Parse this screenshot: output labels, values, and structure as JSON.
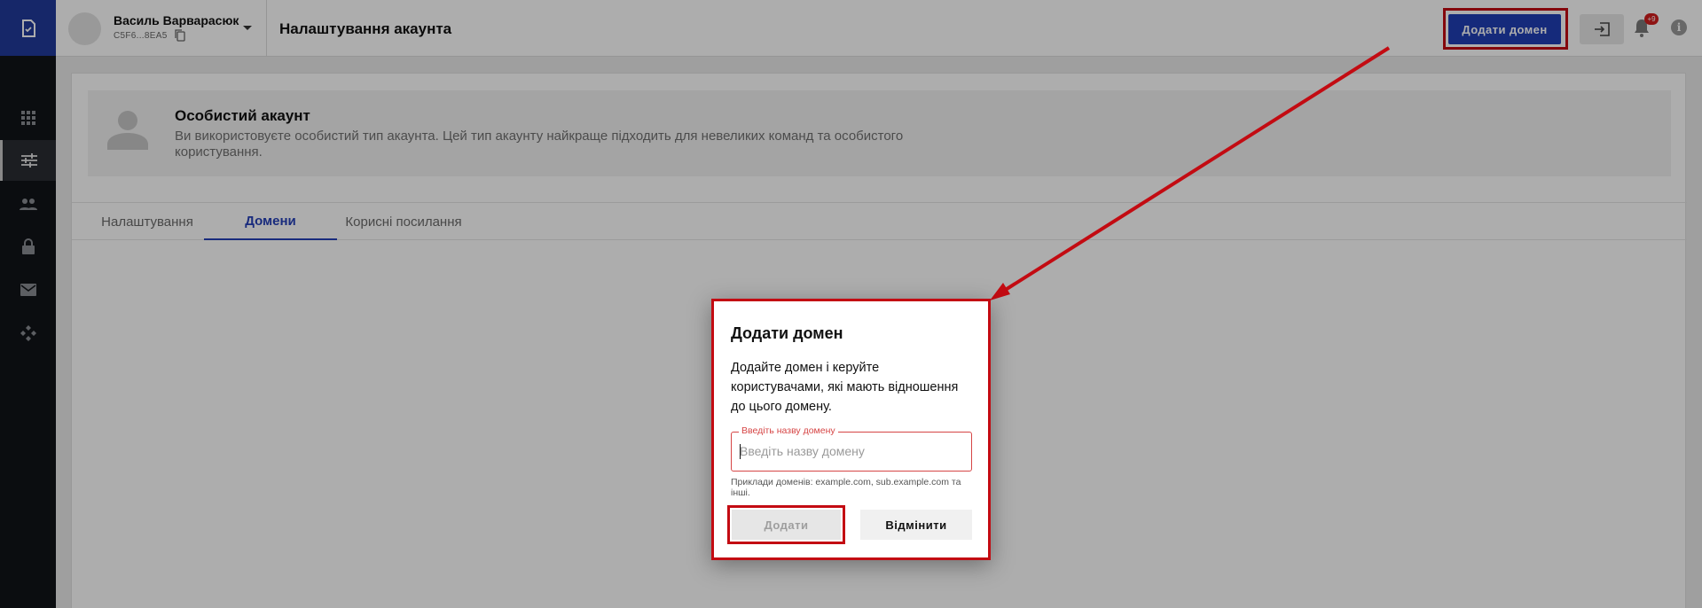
{
  "account": {
    "name": "Василь Варварасюк",
    "id": "C5F6...8EA5"
  },
  "header": {
    "title": "Налаштування акаунта",
    "add_domain_label": "Додати домен",
    "notification_count": "+9",
    "info_glyph": "i"
  },
  "sidebar": {
    "items": [
      {
        "icon": "apps-icon"
      },
      {
        "icon": "settings-sliders-icon",
        "active": true
      },
      {
        "icon": "people-icon"
      },
      {
        "icon": "lock-icon"
      },
      {
        "icon": "mail-icon"
      },
      {
        "icon": "integrations-icon"
      }
    ]
  },
  "banner": {
    "title": "Особистий акаунт",
    "description": "Ви використовуєте особистий тип акаунта. Цей тип акаунту найкраще підходить для невеликих команд та особистого користування."
  },
  "tabs": [
    {
      "label": "Налаштування",
      "active": false
    },
    {
      "label": "Домени",
      "active": true
    },
    {
      "label": "Корисні посилання",
      "active": false
    }
  ],
  "modal": {
    "title": "Додати домен",
    "description": "Додайте домен і керуйте користувачами, які мають відношення до цього домену.",
    "field_label": "Введіть назву домену",
    "field_placeholder": "Введіть назву домену",
    "field_value": "",
    "hint": "Приклади доменів: example.com, sub.example.com та інші.",
    "add_label": "Додати",
    "cancel_label": "Відмінити"
  },
  "colors": {
    "brand": "#1f3fb5",
    "highlight": "#c30b12",
    "error": "#d64545",
    "rail": "#111419"
  }
}
